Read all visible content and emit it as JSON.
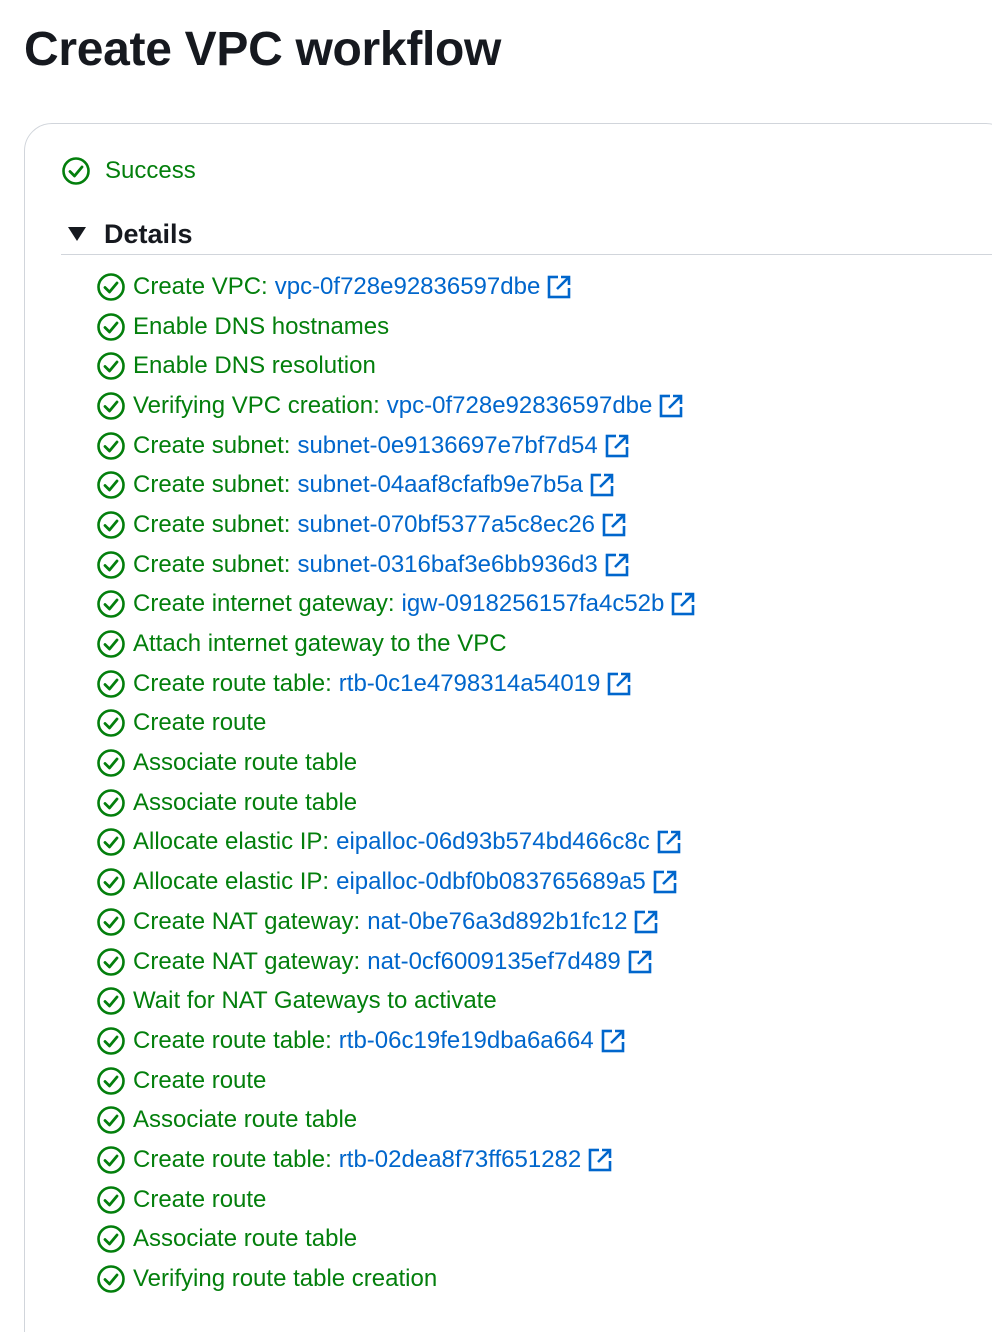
{
  "title": "Create VPC workflow",
  "status": {
    "text": "Success",
    "icon": "check-circle-icon",
    "color": "#037f0c"
  },
  "details": {
    "title": "Details",
    "expanded": true,
    "steps": [
      {
        "label": "Create VPC:",
        "resource": "vpc-0f728e92836597dbe"
      },
      {
        "label": "Enable DNS hostnames"
      },
      {
        "label": "Enable DNS resolution"
      },
      {
        "label": "Verifying VPC creation:",
        "resource": "vpc-0f728e92836597dbe"
      },
      {
        "label": "Create subnet:",
        "resource": "subnet-0e9136697e7bf7d54"
      },
      {
        "label": "Create subnet:",
        "resource": "subnet-04aaf8cfafb9e7b5a"
      },
      {
        "label": "Create subnet:",
        "resource": "subnet-070bf5377a5c8ec26"
      },
      {
        "label": "Create subnet:",
        "resource": "subnet-0316baf3e6bb936d3"
      },
      {
        "label": "Create internet gateway:",
        "resource": "igw-0918256157fa4c52b"
      },
      {
        "label": "Attach internet gateway to the VPC"
      },
      {
        "label": "Create route table:",
        "resource": "rtb-0c1e4798314a54019"
      },
      {
        "label": "Create route"
      },
      {
        "label": "Associate route table"
      },
      {
        "label": "Associate route table"
      },
      {
        "label": "Allocate elastic IP:",
        "resource": "eipalloc-06d93b574bd466c8c"
      },
      {
        "label": "Allocate elastic IP:",
        "resource": "eipalloc-0dbf0b083765689a5"
      },
      {
        "label": "Create NAT gateway:",
        "resource": "nat-0be76a3d892b1fc12"
      },
      {
        "label": "Create NAT gateway:",
        "resource": "nat-0cf6009135ef7d489"
      },
      {
        "label": "Wait for NAT Gateways to activate"
      },
      {
        "label": "Create route table:",
        "resource": "rtb-06c19fe19dba6a664"
      },
      {
        "label": "Create route"
      },
      {
        "label": "Associate route table"
      },
      {
        "label": "Create route table:",
        "resource": "rtb-02dea8f73ff651282"
      },
      {
        "label": "Create route"
      },
      {
        "label": "Associate route table"
      },
      {
        "label": "Verifying route table creation"
      }
    ]
  },
  "colors": {
    "success": "#037f0c",
    "link": "#0066cc",
    "text": "#16191f",
    "border": "#d1d5db"
  }
}
